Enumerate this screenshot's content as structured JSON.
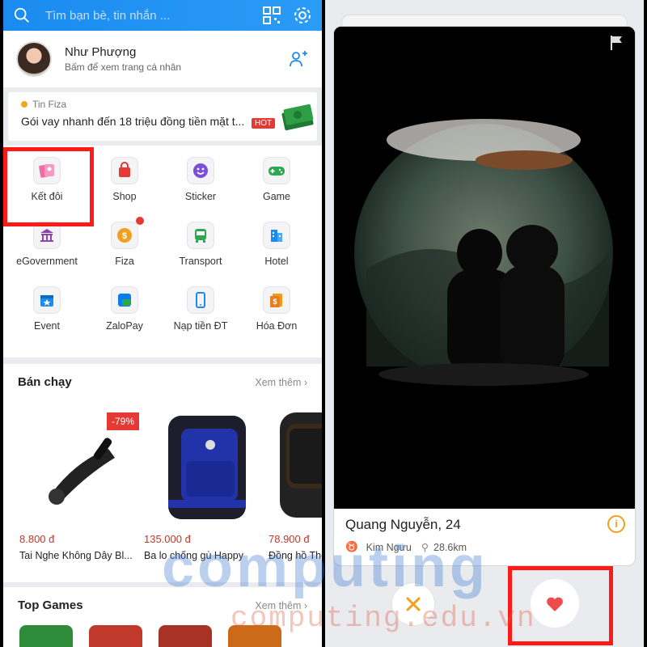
{
  "left": {
    "search": {
      "placeholder": "Tìm bạn bè, tin nhắn ..."
    },
    "profile": {
      "name": "Như Phượng",
      "subtitle": "Bấm để xem trang cá nhân"
    },
    "ad": {
      "source": "Tin Fiza",
      "text": "Gói vay nhanh đến 18 triệu đồng tiền mặt t...",
      "badge": "HOT"
    },
    "apps": [
      {
        "label": "Kết đôi",
        "icon": "match-icon"
      },
      {
        "label": "Shop",
        "icon": "shop-icon"
      },
      {
        "label": "Sticker",
        "icon": "sticker-icon"
      },
      {
        "label": "Game",
        "icon": "gamepad-icon"
      },
      {
        "label": "eGovernment",
        "icon": "government-icon"
      },
      {
        "label": "Fiza",
        "icon": "fiza-icon"
      },
      {
        "label": "Transport",
        "icon": "bus-icon"
      },
      {
        "label": "Hotel",
        "icon": "hotel-icon"
      },
      {
        "label": "Event",
        "icon": "event-icon"
      },
      {
        "label": "ZaloPay",
        "icon": "zalopay-icon"
      },
      {
        "label": "Nạp tiền ĐT",
        "icon": "phone-topup-icon"
      },
      {
        "label": "Hóa Đơn",
        "icon": "bill-icon"
      }
    ],
    "best_sellers": {
      "title": "Bán chạy",
      "more": "Xem thêm",
      "discount": "-79%",
      "products": [
        {
          "price": "8.800 đ",
          "name": "Tai Nghe Không Dây Bl..."
        },
        {
          "price": "135.000 đ",
          "name": "Ba lo chống gù Happy"
        },
        {
          "price": "78.900 đ",
          "name": "Đồng hồ Thờ"
        }
      ]
    },
    "top_games": {
      "title": "Top Games",
      "more": "Xem thêm"
    }
  },
  "right": {
    "card": {
      "name": "Quang Nguyễn, 24",
      "zodiac": "Kim Ngưu",
      "distance": "28.6km",
      "info": "i"
    }
  },
  "watermark": {
    "line1": "computing",
    "line2": "computing.edu.vn"
  },
  "colors": {
    "accent": "#1a8bf0",
    "highlight": "#ff1a1a",
    "price": "#c0392b",
    "heart": "#ef4b4b"
  }
}
